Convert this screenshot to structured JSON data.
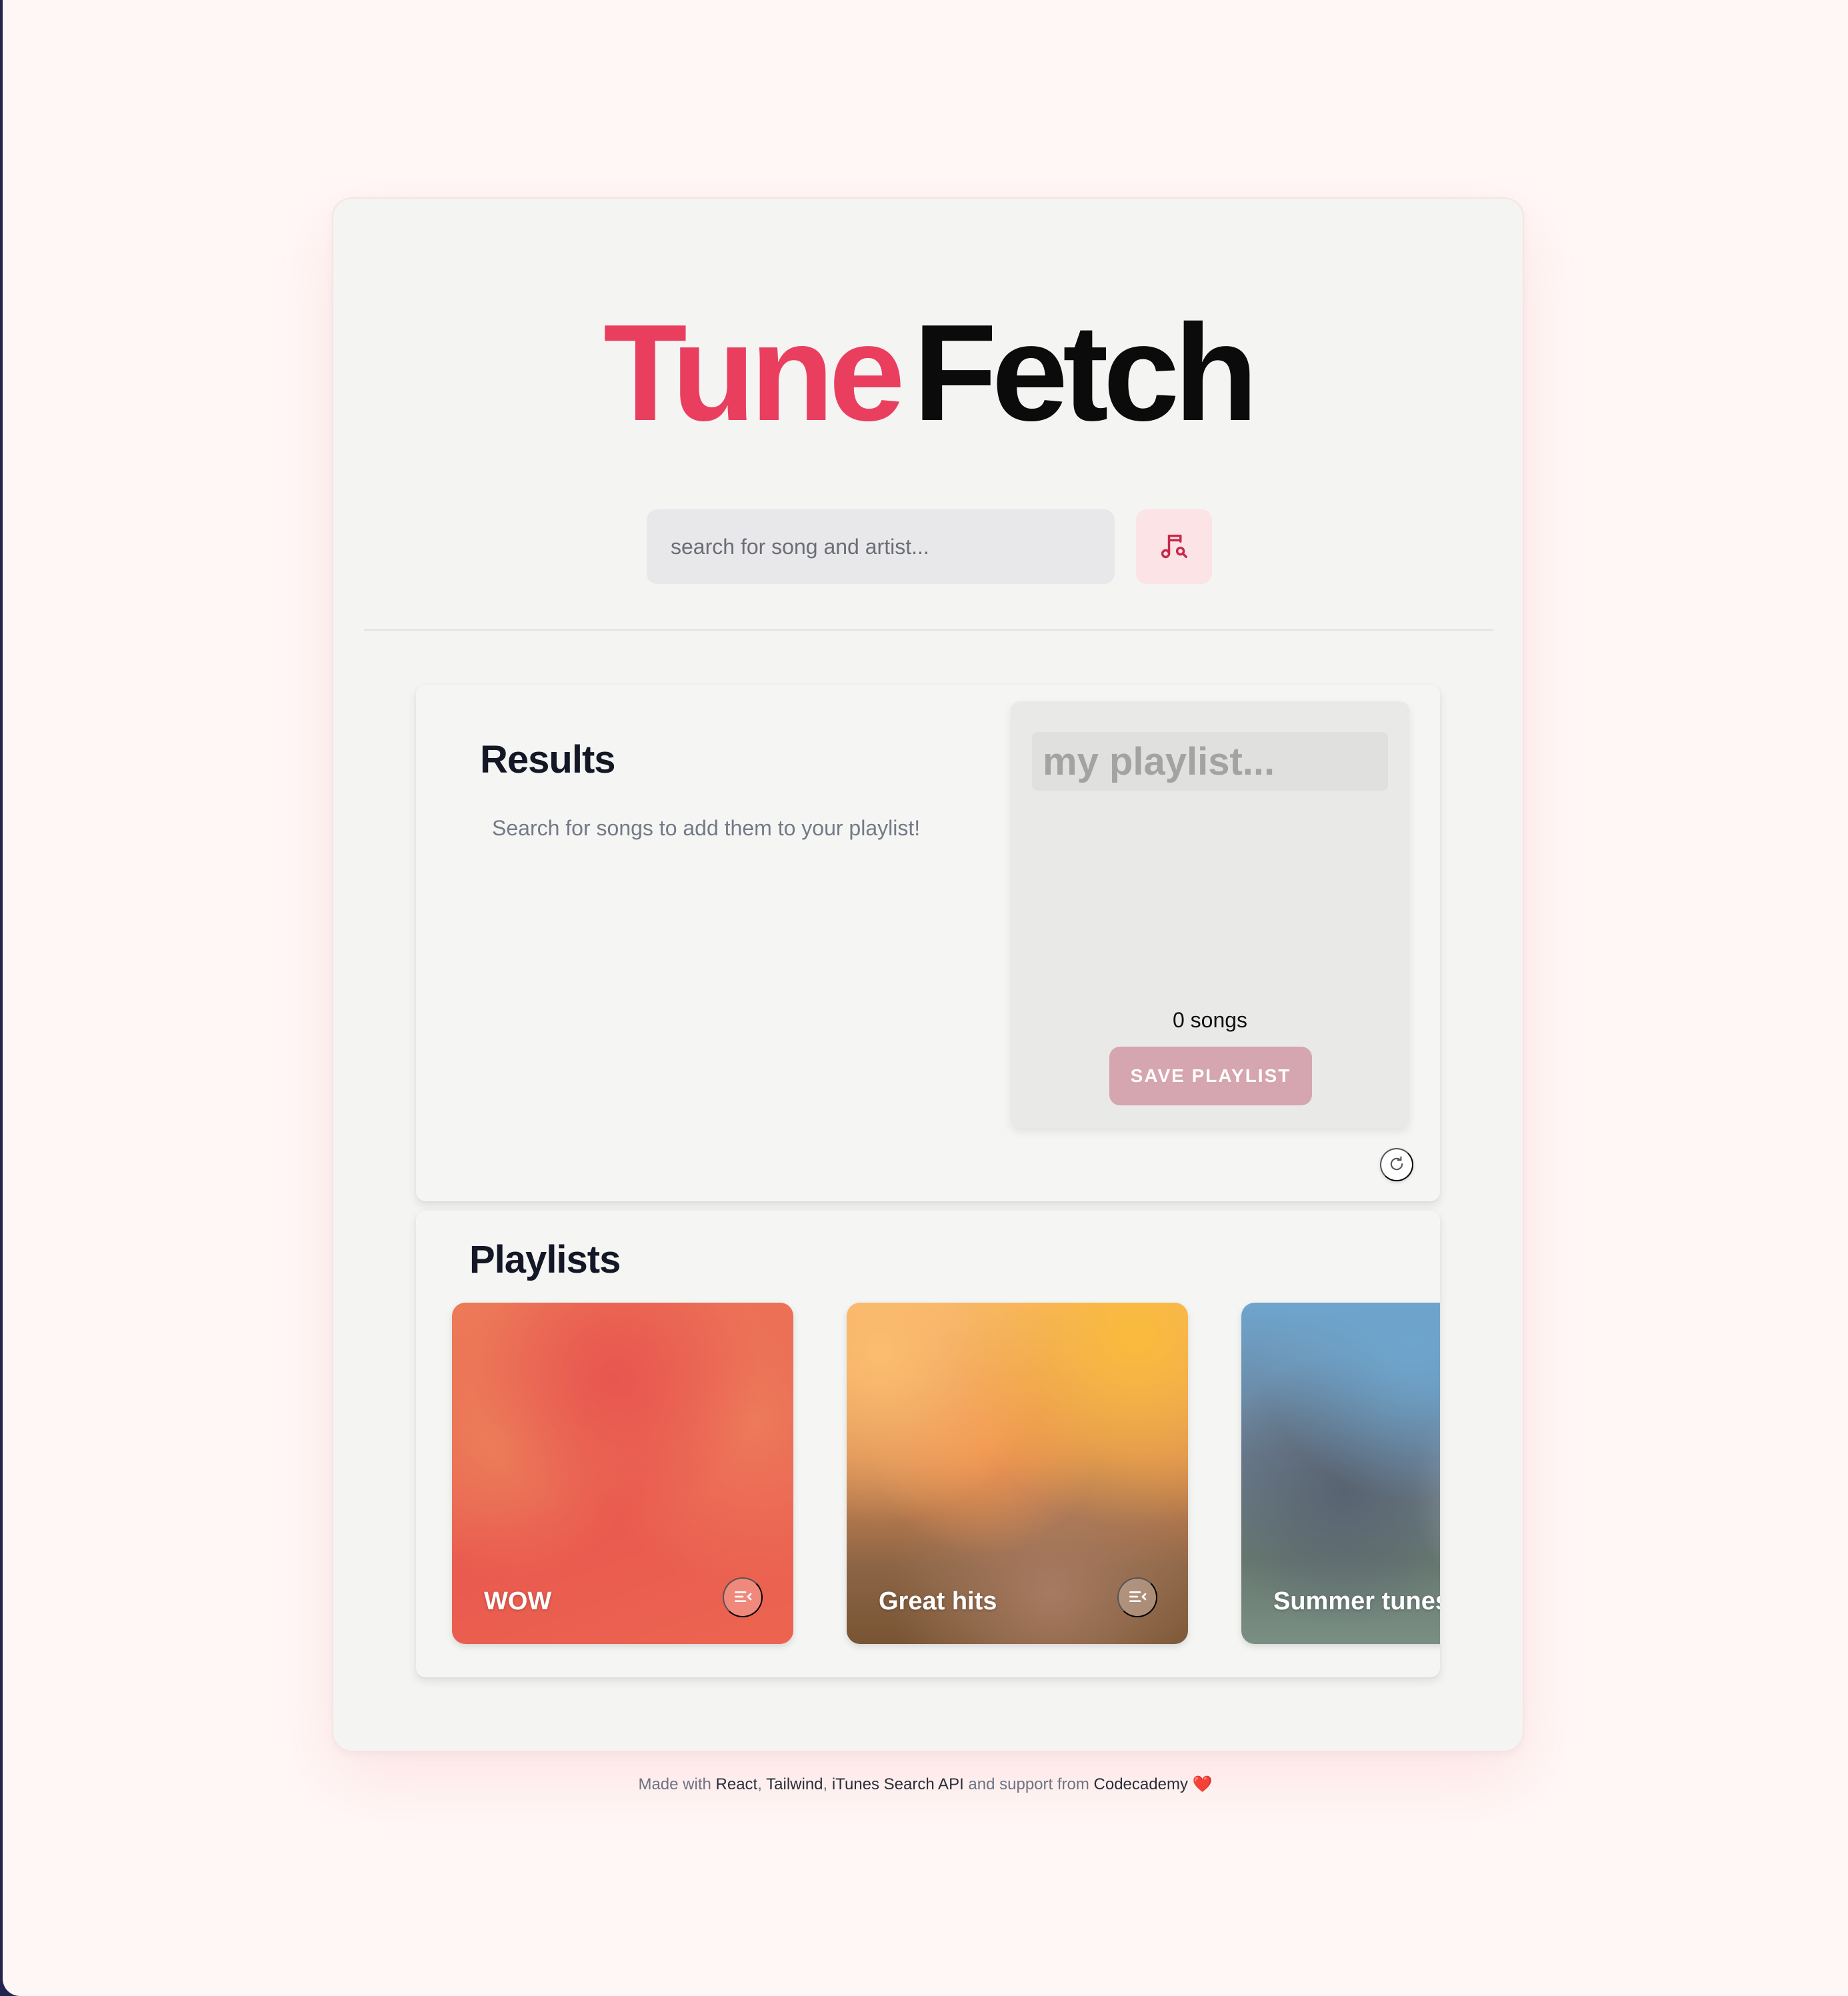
{
  "header": {
    "logo_part1": "Tune",
    "logo_part2": "Fetch"
  },
  "search": {
    "placeholder": "search for song and artist...",
    "value": "",
    "button_icon": "music-search-icon"
  },
  "results": {
    "title": "Results",
    "empty_message": "Search for songs to add them to your playlist!"
  },
  "playlist_editor": {
    "name_placeholder": "my playlist...",
    "name_value": "",
    "song_count": "0 songs",
    "save_label": "SAVE PLAYLIST",
    "refresh_icon": "refresh-icon"
  },
  "playlists": {
    "title": "Playlists",
    "items": [
      {
        "name": "WOW",
        "action_icon": "playlist-load-icon"
      },
      {
        "name": "Great hits",
        "action_icon": "playlist-load-icon"
      },
      {
        "name": "Summer tunes",
        "action_icon": "playlist-load-icon"
      }
    ]
  },
  "footer": {
    "prefix": "Made with",
    "link_react": "React",
    "sep1": ",",
    "link_tailwind": "Tailwind",
    "sep2": ",",
    "link_itunes": "iTunes Search API",
    "middle": "and support from",
    "link_codecademy": "Codecademy",
    "heart": "❤️"
  },
  "colors": {
    "accent": "#ea3e5f",
    "page_background": "#fff7f6",
    "card_background": "#f4f4f3",
    "save_button": "#d5a5b0"
  }
}
